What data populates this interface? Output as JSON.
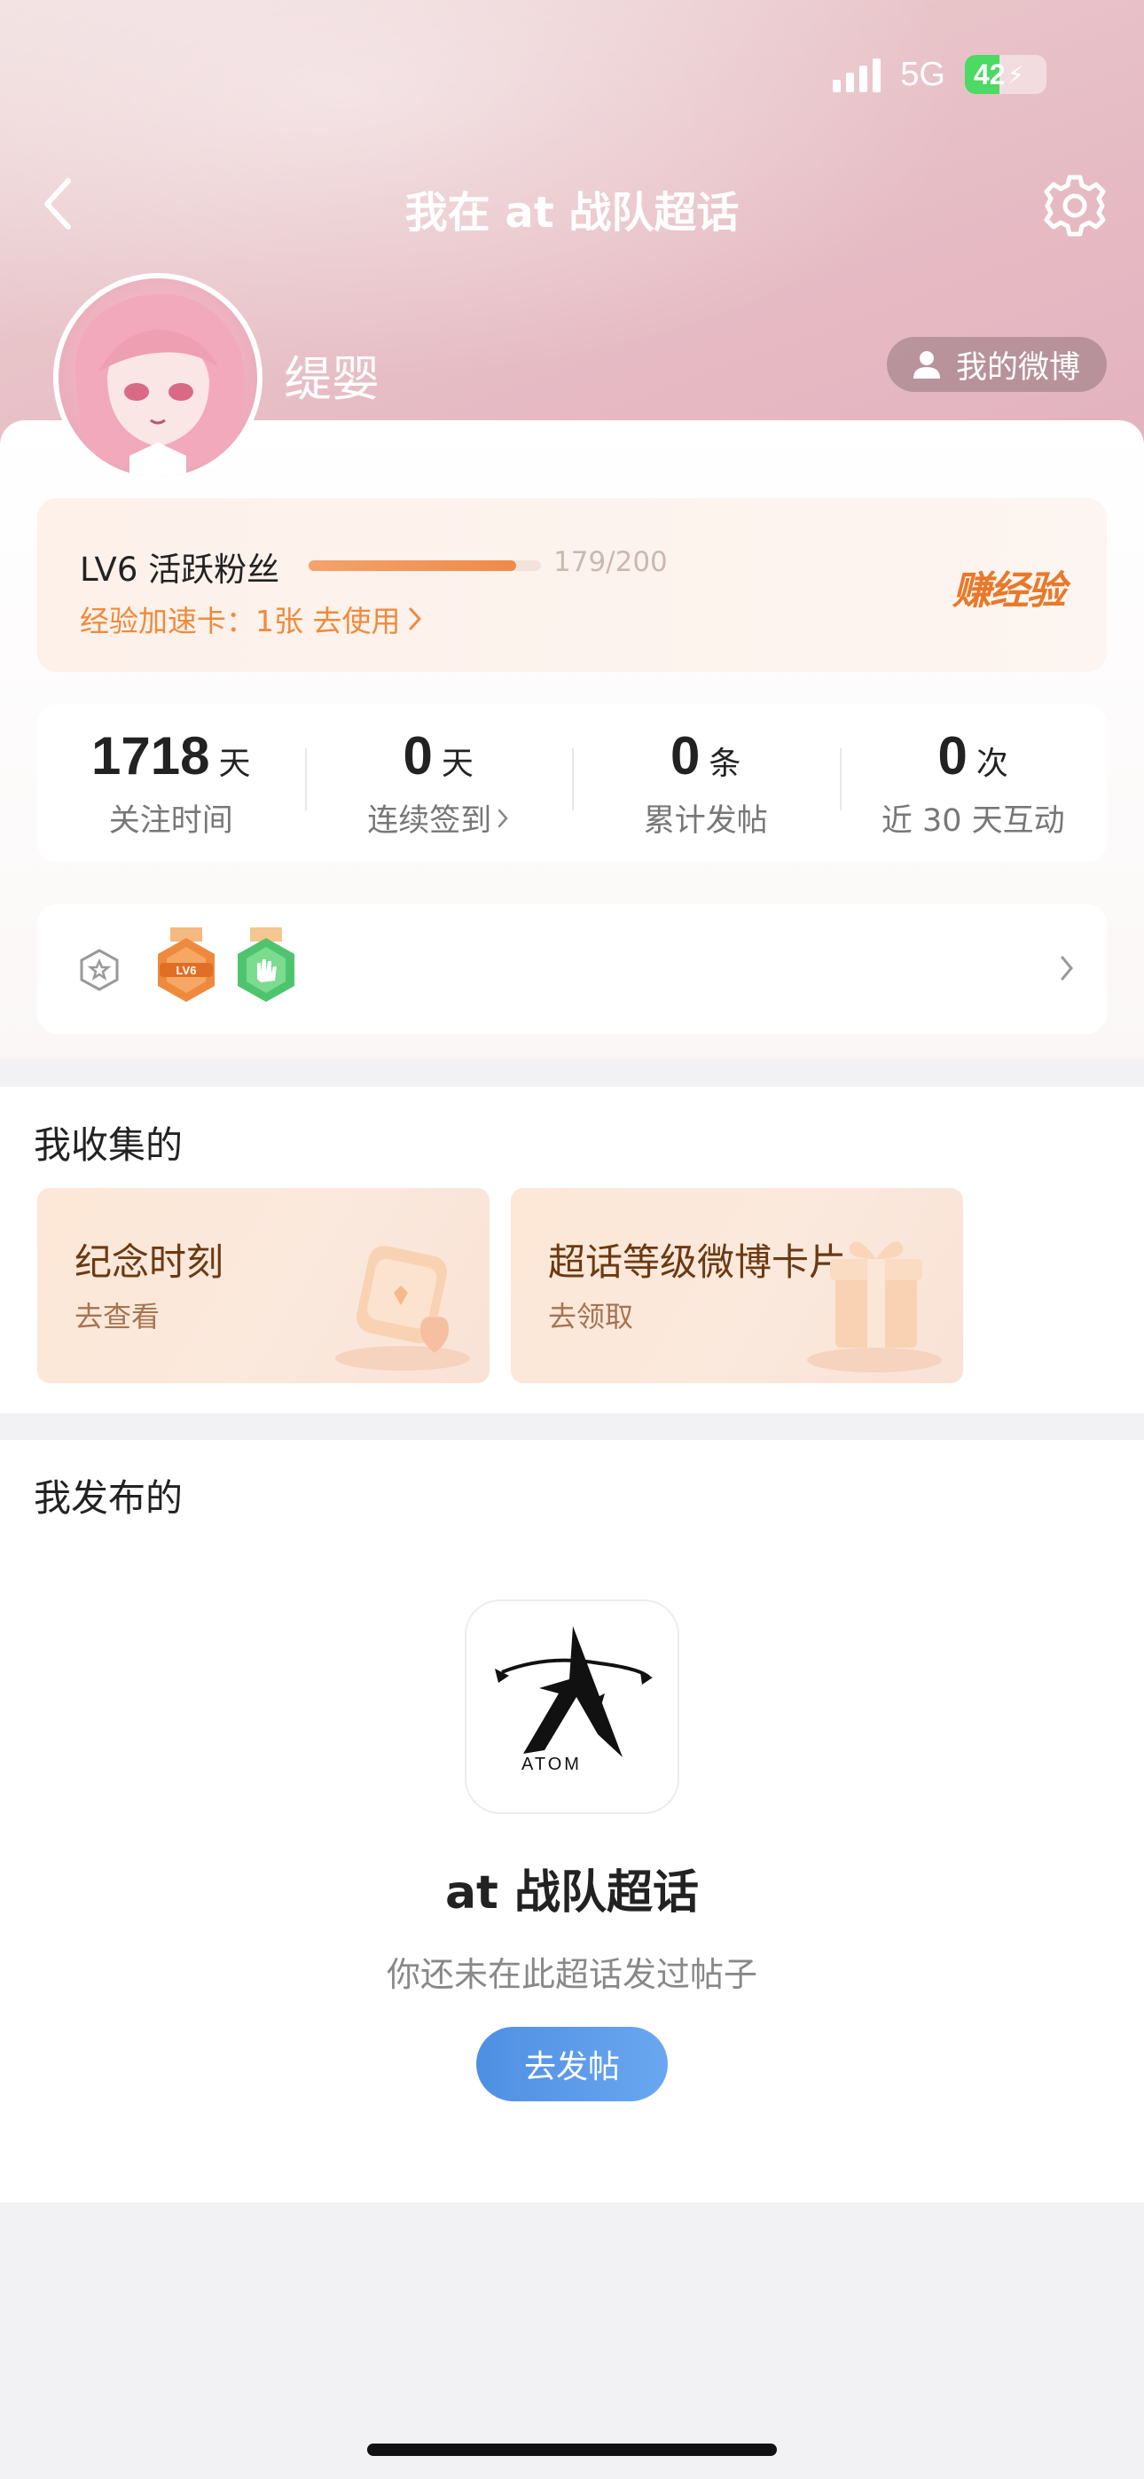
{
  "status_bar": {
    "network": "5G",
    "battery": "42",
    "battery_level": 0.42
  },
  "nav": {
    "title": "我在 at 战队超话"
  },
  "profile": {
    "username": "缇婴",
    "my_weibo_label": "我的微博"
  },
  "level": {
    "name": "LV6 活跃粉丝",
    "progress_text": "179/200",
    "progress_value": 179,
    "progress_max": 200,
    "exp_card_text": "经验加速卡：1张 去使用",
    "earn_exp_label": "赚经验"
  },
  "stats": [
    {
      "value": "1718",
      "unit": "天",
      "label": "关注时间"
    },
    {
      "value": "0",
      "unit": "天",
      "label": "连续签到"
    },
    {
      "value": "0",
      "unit": "条",
      "label": "累计发帖"
    },
    {
      "value": "0",
      "unit": "次",
      "label": "近 30 天互动"
    }
  ],
  "badges": {
    "icons": [
      "badge-outline-icon",
      "lv6-medal-icon",
      "green-medal-icon"
    ],
    "lv6_text": "LV6"
  },
  "collections": {
    "title": "我收集的",
    "cards": [
      {
        "title": "纪念时刻",
        "subtitle": "去查看"
      },
      {
        "title": "超话等级微博卡片",
        "subtitle": "去领取"
      }
    ]
  },
  "posts": {
    "title": "我发布的",
    "logo_text": "ATOM",
    "topic_name": "at 战队超话",
    "empty_desc": "你还未在此超话发过帖子",
    "post_button": "去发帖"
  },
  "colors": {
    "accent_orange": "#ef8a3c",
    "button_blue": "#5b9be8",
    "header_pink": "#e8c4c9"
  }
}
